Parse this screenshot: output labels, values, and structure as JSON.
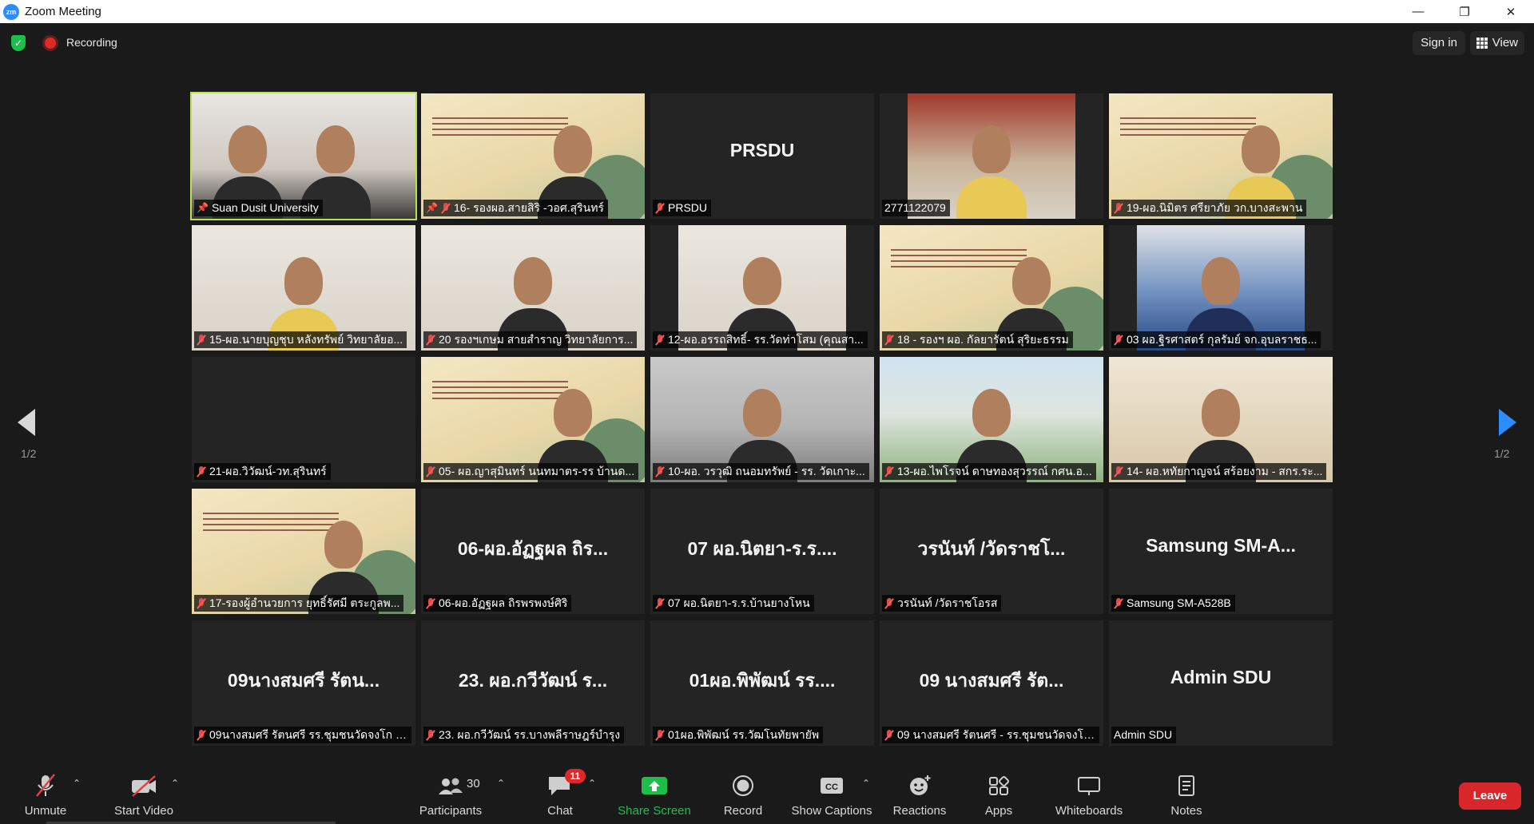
{
  "window": {
    "logo_text": "zm",
    "title": "Zoom Meeting",
    "controls": {
      "minimize": "—",
      "restore": "❐",
      "close": "✕"
    }
  },
  "topbar": {
    "recording_label": "Recording",
    "sign_in": "Sign in",
    "view": "View"
  },
  "pagination": {
    "left": "1/2",
    "right": "1/2"
  },
  "tiles": [
    {
      "big": "",
      "label": "Suan Dusit University",
      "pinned": true,
      "video": "room"
    },
    {
      "big": "",
      "label": "16- รองผอ.สายสิริ -วอศ.สุรินทร์",
      "pinned": true,
      "video": "slide"
    },
    {
      "big": "PRSDU",
      "label": "PRSDU",
      "video": "none"
    },
    {
      "big": "",
      "label": "2771122079",
      "video": "office"
    },
    {
      "big": "",
      "label": "19-ผอ.นิมิตร ศรียาภัย วก.บางสะพาน",
      "video": "slide"
    },
    {
      "big": "",
      "label": "15-ผอ.นายบุญชุบ หลังทรัพย์ วิทยาลัยอ...",
      "video": "wall"
    },
    {
      "big": "",
      "label": "20 รองฯเกษม สายสำราญ วิทยาลัยการ...",
      "video": "wall"
    },
    {
      "big": "",
      "label": "12-ผอ.อรรถสิทธิ์- รร.วัดท่าโสม (คุณสา...",
      "video": "wall"
    },
    {
      "big": "",
      "label": "18 - รองฯ ผอ. กัลยารัตน์ สุริยะธรรม",
      "video": "slide"
    },
    {
      "big": "",
      "label": "03 ผอ.ฐิรศาสตร์ กุลรัมย์ จก.อุบลราชธ...",
      "video": "blue"
    },
    {
      "big": "",
      "label": "21-ผอ.วิวัฒน์-วท.สุรินทร์",
      "video": "none"
    },
    {
      "big": "",
      "label": "05- ผอ.ญาสุมินทร์ นนทมาตร-รร บ้านด...",
      "video": "slide"
    },
    {
      "big": "",
      "label": "10-ผอ. วรวุฒิ ถนอมทรัพย์ - รร. วัดเกาะ...",
      "video": "blur"
    },
    {
      "big": "",
      "label": "13-ผอ.ไพโรจน์ ดาษทองสุวรรณ์ กศน.อ...",
      "video": "outdoor"
    },
    {
      "big": "",
      "label": "14- ผอ.หทัยกาญจน์ สร้อยงาม - สกร.ระ...",
      "video": "frames"
    },
    {
      "big": "",
      "label": "17-รองผู้อำนวยการ ยุทธิ์รัศมี ตระกูลพ...",
      "video": "slide"
    },
    {
      "big": "06-ผอ.อัฏฐผล ถิร...",
      "label": "06-ผอ.อัฏฐผล ถิรพรพงษ์ศิริ",
      "video": "none"
    },
    {
      "big": "07 ผอ.นิตยา-ร.ร....",
      "label": "07 ผอ.นิตยา-ร.ร.บ้านยางโหน",
      "video": "none"
    },
    {
      "big": "วรนันท์ /วัดราชโ...",
      "label": "วรนันท์ /วัดราชโอรส",
      "video": "none"
    },
    {
      "big": "Samsung SM-A...",
      "label": "Samsung SM-A528B",
      "video": "none"
    },
    {
      "big": "09นางสมศรี รัตน...",
      "label": "09นางสมศรี รัตนศรี รร.ชุมชนวัดจงโก มิ...",
      "video": "none"
    },
    {
      "big": "23. ผอ.กวีวัฒน์ ร...",
      "label": "23. ผอ.กวีวัฒน์ รร.บางพลีราษฎร์บำรุง",
      "video": "none"
    },
    {
      "big": "01ผอ.พิพัฒน์ รร....",
      "label": "01ผอ.พิพัฒน์ รร.วัฒโนทัยพายัพ",
      "video": "none"
    },
    {
      "big": "09 นางสมศรี รัต...",
      "label": "09 นางสมศรี รัตนศรี - รร.ชุมชนวัดจงโก...",
      "video": "none"
    },
    {
      "big": "Admin SDU",
      "label": "Admin SDU",
      "video": "none",
      "unmuted": true
    }
  ],
  "toolbar": {
    "unmute": "Unmute",
    "start_video": "Start Video",
    "participants": "Participants",
    "participants_count": "30",
    "chat": "Chat",
    "chat_badge": "11",
    "share_screen": "Share Screen",
    "record": "Record",
    "show_captions": "Show Captions",
    "captions_icon": "CC",
    "reactions": "Reactions",
    "apps": "Apps",
    "whiteboards": "Whiteboards",
    "notes": "Notes",
    "leave": "Leave"
  },
  "colors": {
    "background": "#1a1a1a",
    "active_speaker": "#b8e34a",
    "accent_blue": "#2d8cff",
    "leave_red": "#d9262b",
    "share_green": "#1dbf4a"
  }
}
